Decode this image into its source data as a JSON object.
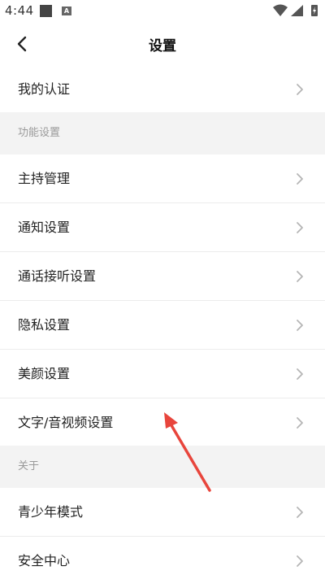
{
  "status_bar": {
    "time": "4:44",
    "badge_letter": "A",
    "icons": [
      "wifi-icon",
      "signal-icon",
      "battery-charging-icon"
    ]
  },
  "header": {
    "title": "设置"
  },
  "items": [
    {
      "label": "我的认证"
    }
  ],
  "sections": [
    {
      "title": "功能设置",
      "items": [
        {
          "label": "主持管理"
        },
        {
          "label": "通知设置"
        },
        {
          "label": "通话接听设置"
        },
        {
          "label": "隐私设置"
        },
        {
          "label": "美颜设置"
        },
        {
          "label": "文字/音视频设置"
        }
      ]
    },
    {
      "title": "关于",
      "items": [
        {
          "label": "青少年模式"
        },
        {
          "label": "安全中心"
        }
      ]
    }
  ],
  "colors": {
    "accent_arrow": "#e8453c",
    "section_bg": "#f3f3f3",
    "chevron": "#b5b5b5"
  }
}
